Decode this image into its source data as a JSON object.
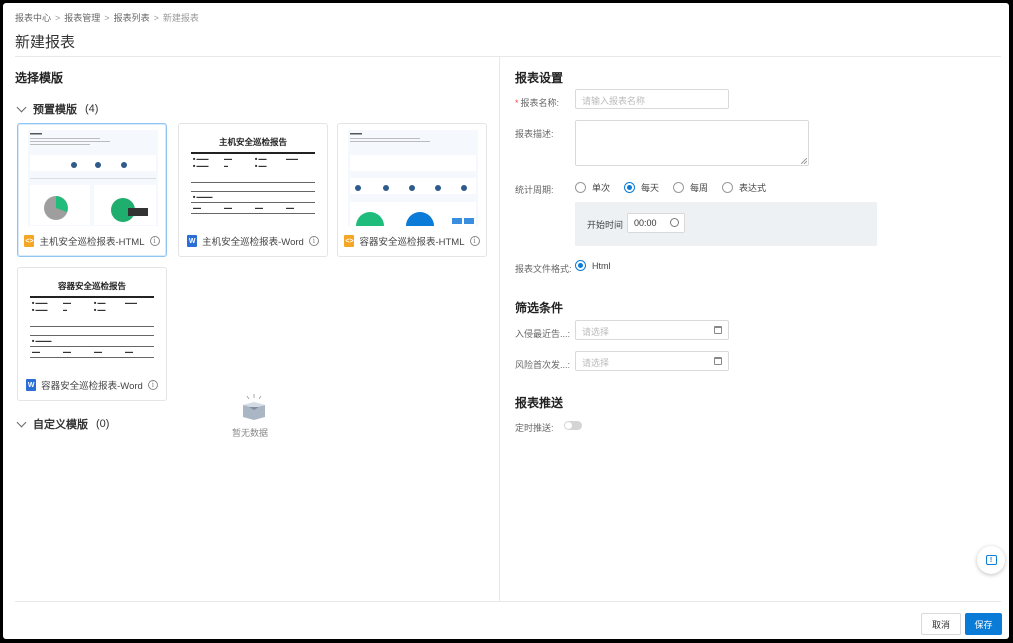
{
  "breadcrumb": [
    "报表中心",
    "报表管理",
    "报表列表",
    "新建报表"
  ],
  "breadcrumb_sep": ">",
  "page_title": "新建报表",
  "left": {
    "title": "选择模版",
    "preset_group": {
      "label": "预置模版",
      "count": "(4)"
    },
    "templates": [
      {
        "label": "主机安全巡检报表-HTML",
        "type": "html"
      },
      {
        "label": "主机安全巡检报表-Word",
        "type": "word",
        "doc_title": "主机安全巡检报告"
      },
      {
        "label": "容器安全巡检报表-HTML",
        "type": "html"
      },
      {
        "label": "容器安全巡检报表-Word",
        "type": "word",
        "doc_title": "容器安全巡检报告"
      }
    ],
    "custom_group": {
      "label": "自定义模版",
      "count": "(0)"
    },
    "empty_text": "暂无数据"
  },
  "right": {
    "settings_title": "报表设置",
    "name_label": "报表名称:",
    "name_required": "*",
    "name_placeholder": "请输入报表名称",
    "desc_label": "报表描述:",
    "period_label": "统计周期:",
    "period_options": [
      "单次",
      "每天",
      "每周",
      "表达式"
    ],
    "period_selected": "每天",
    "start_time_label": "开始时间",
    "start_time_value": "00:00",
    "format_label": "报表文件格式:",
    "format_value": "Html",
    "filter_title": "筛选条件",
    "filter1_label": "入侵最近告...:",
    "filter1_placeholder": "请选择",
    "filter2_label": "风险首次发...:",
    "filter2_placeholder": "请选择",
    "push_title": "报表推送",
    "push_label": "定时推送:",
    "push_enabled": false
  },
  "footer": {
    "cancel": "取消",
    "save": "保存"
  },
  "colors": {
    "primary": "#0a7bd6",
    "html_icon": "#f5a623",
    "word_icon": "#2b6fd6"
  }
}
